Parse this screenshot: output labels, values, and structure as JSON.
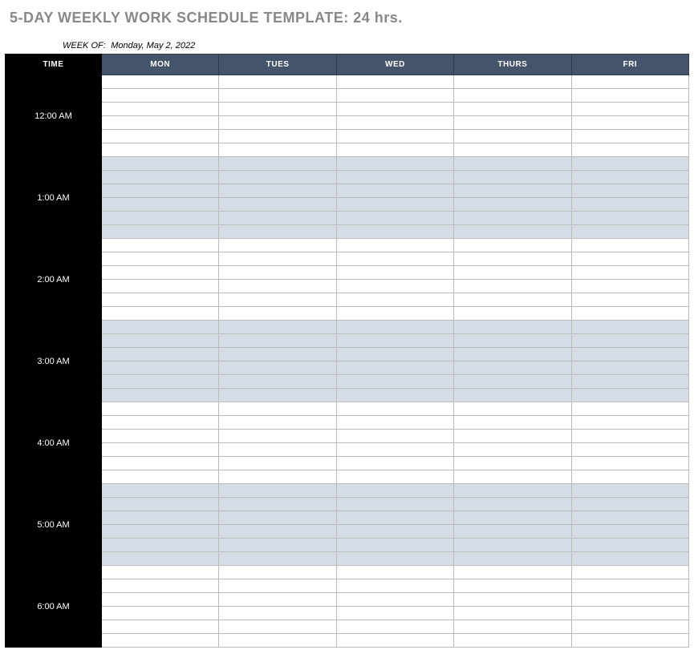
{
  "title": "5-DAY WEEKLY WORK SCHEDULE TEMPLATE: 24 hrs.",
  "week_of_label": "WEEK OF:",
  "week_of_value": "Monday, May 2, 2022",
  "headers": {
    "time": "TIME",
    "days": [
      "MON",
      "TUES",
      "WED",
      "THURS",
      "FRI"
    ]
  },
  "hours": [
    {
      "label": "12:00 AM",
      "shaded": false
    },
    {
      "label": "1:00 AM",
      "shaded": true
    },
    {
      "label": "2:00 AM",
      "shaded": false
    },
    {
      "label": "3:00 AM",
      "shaded": true
    },
    {
      "label": "4:00 AM",
      "shaded": false
    },
    {
      "label": "5:00 AM",
      "shaded": true
    },
    {
      "label": "6:00 AM",
      "shaded": false
    }
  ],
  "rows_per_hour": 6,
  "day_count": 5
}
